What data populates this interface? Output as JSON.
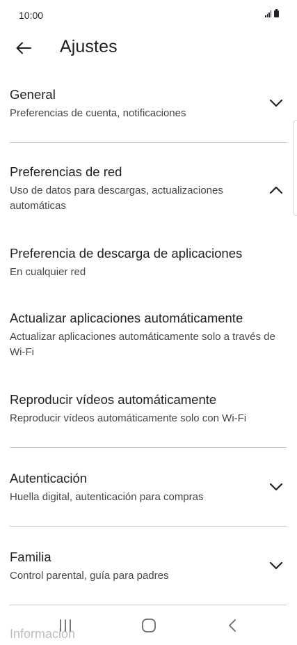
{
  "status": {
    "time": "10:00"
  },
  "header": {
    "title": "Ajustes"
  },
  "settings": {
    "general": {
      "title": "General",
      "subtitle": "Preferencias de cuenta, notificaciones"
    },
    "network": {
      "title": "Preferencias de red",
      "subtitle": "Uso de datos para descargas, actualizaciones automáticas"
    },
    "download_pref": {
      "title": "Preferencia de descarga de aplicaciones",
      "subtitle": "En cualquier red"
    },
    "auto_update": {
      "title": "Actualizar aplicaciones automáticamente",
      "subtitle": "Actualizar aplicaciones automáticamente solo a través de Wi-Fi"
    },
    "autoplay": {
      "title": "Reproducir vídeos automáticamente",
      "subtitle": "Reproducir vídeos automáticamente solo con Wi-Fi"
    },
    "auth": {
      "title": "Autenticación",
      "subtitle": "Huella digital, autenticación para compras"
    },
    "family": {
      "title": "Familia",
      "subtitle": "Control parental, guía para padres"
    },
    "info": {
      "title": "Información"
    }
  },
  "icons": {
    "back": "arrow-left-icon",
    "expand": "chevron-down-icon",
    "collapse": "chevron-up-icon",
    "recents": "recents-icon",
    "home": "home-icon",
    "nav_back": "nav-back-icon"
  }
}
